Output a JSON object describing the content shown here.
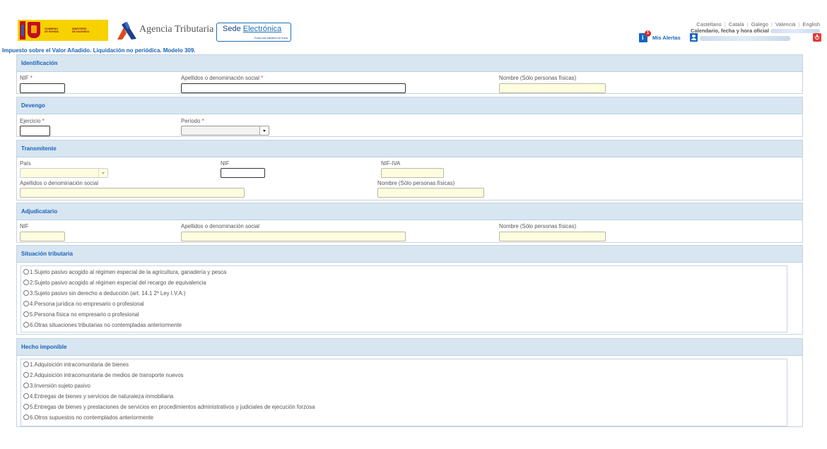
{
  "header": {
    "gov_line1": "GOBIERNO\nDE ESPAÑA",
    "gov_line2": "MINISTERIO\nDE HACIENDA",
    "agency": "Agencia Tributaria",
    "sede_part1": "Sede",
    "sede_part2": "Electrónica",
    "sede_sub": "Todos los trámites en línea",
    "languages": [
      "Castellano",
      "Català",
      "Galego",
      "Valencià",
      "English"
    ],
    "calendar": "Calendario, fecha y hora oficial",
    "alerts_count": "1",
    "alerts_label": "Mis Alertas"
  },
  "page_title": "Impuesto sobre el Valor Añadido. Liquidación no periódica. Modelo 309.",
  "required_mark": "*",
  "identificacion": {
    "title": "Identificación",
    "nif": "NIF",
    "apellidos": "Apellidos o denominación social",
    "nombre": "Nombre (Sólo personas físicas)"
  },
  "devengo": {
    "title": "Devengo",
    "ejercicio": "Ejercicio",
    "periodo": "Período"
  },
  "transmitente": {
    "title": "Transmitente",
    "pais": "País",
    "nif": "NIF",
    "nif_iva": "NIF-IVA",
    "apellidos": "Apellidos o denominación social",
    "nombre": "Nombre (Sólo personas físicas)"
  },
  "adjudicatario": {
    "title": "Adjudicatario",
    "nif": "NIF",
    "apellidos": "Apellidos o denominación social",
    "nombre": "Nombre (Sólo personas físicas)"
  },
  "situacion": {
    "title": "Situación tributaria",
    "options": [
      "1.Sujeto pasivo acogido al régimen especial de la agricultura, ganadería y pesca",
      "2.Sujeto pasivo acogido al régimen especial del recargo de equivalencia",
      "3.Sujeto pasivo sin derecho a deducción (art. 14.1 2º Ley I.V.A.)",
      "4.Persona jurídica no empresario o profesional",
      "5.Persona física no empresario o profesional",
      "6.Otras situaciones tributarias no contempladas anteriormente"
    ]
  },
  "hecho": {
    "title": "Hecho imponible",
    "options": [
      "1.Adquisición intracomunitaria de bienes",
      "2.Adquisición intracomunitaria de medios de transporte nuevos",
      "3.Inversión sujeto pasivo",
      "4.Entregas de bienes y servicios de naturaleza inmobiliaria",
      "5.Entregas de bienes y prestaciones de servicios en procedimientos administrativos y judiciales de ejecución forzosa",
      "6.Otros supuestos no contemplados anteriormente"
    ]
  },
  "colors": {
    "accent": "#1a63b5",
    "section_header": "#d8e6f1",
    "readonly_input": "#fffde0",
    "required": "#dd3333"
  }
}
